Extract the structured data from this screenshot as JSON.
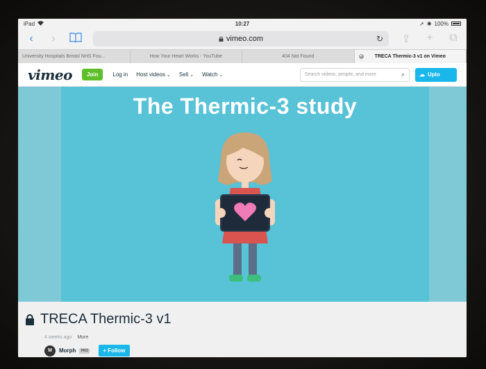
{
  "status": {
    "carrier": "iPad",
    "time": "10:27",
    "battery": "100%"
  },
  "browser": {
    "url": "vimeo.com",
    "tabs": [
      {
        "label": "University Hospitals Bristol NHS Fou..."
      },
      {
        "label": "How Your Heart Works - YouTube"
      },
      {
        "label": "404 Not Found"
      },
      {
        "label": "TRECA Thermic-3 v1 on Vimeo",
        "active": true
      }
    ]
  },
  "vimeo": {
    "logo": "vimeo",
    "join": "Join",
    "login": "Log in",
    "host": "Host videos",
    "sell": "Sell",
    "watch": "Watch",
    "search_placeholder": "Search videos, people, and more",
    "upload": "Uplo"
  },
  "video": {
    "overlay_title": "The Thermic-3 study",
    "title": "TRECA Thermic-3 v1",
    "age": "4 weeks ago",
    "more": "More",
    "owner": "Morph",
    "owner_badge": "PRO",
    "follow": "+ Follow"
  },
  "colors": {
    "video_bg": "#58c2d6",
    "vimeo_blue": "#1ab7ea",
    "join_green": "#5fbf2a",
    "heart_pink": "#ef7bb7"
  }
}
